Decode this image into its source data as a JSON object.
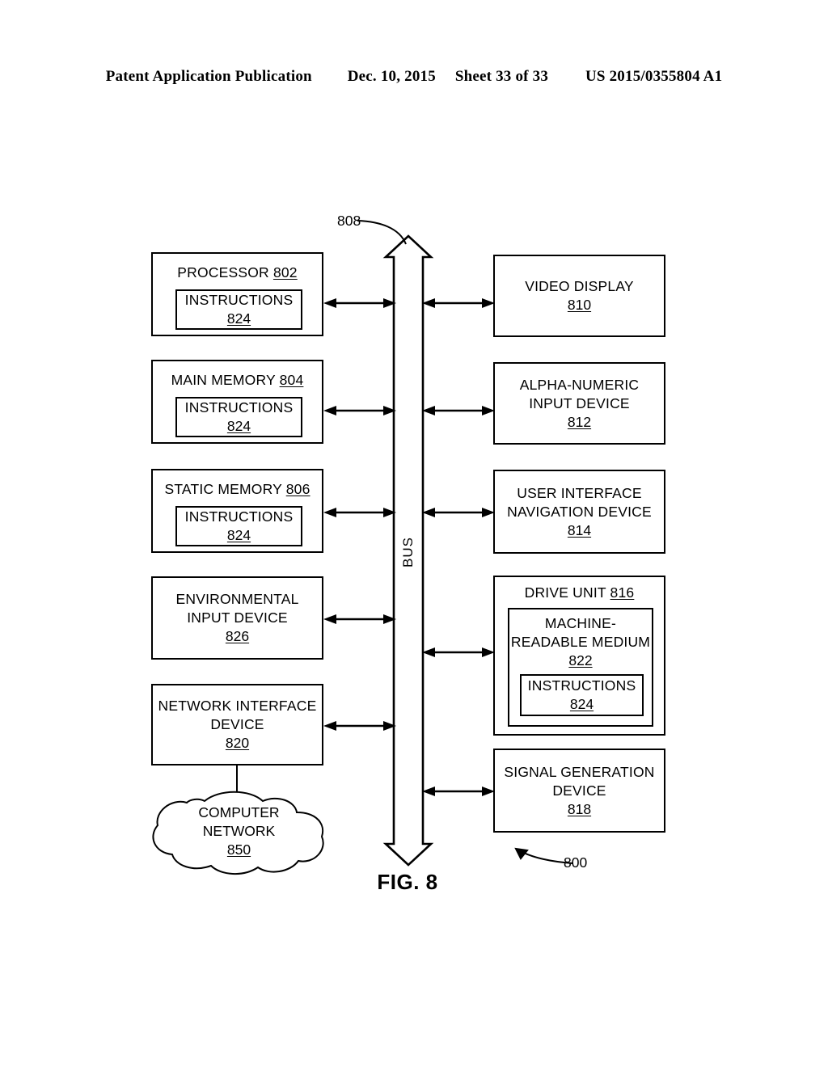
{
  "header": {
    "publication": "Patent Application Publication",
    "date": "Dec. 10, 2015",
    "sheet": "Sheet 33 of 33",
    "patent_number": "US 2015/0355804 A1"
  },
  "figure": {
    "caption": "FIG. 8",
    "system_ref": "800",
    "bus_ref": "808",
    "bus_label": "BUS"
  },
  "left_column": [
    {
      "id": "processor",
      "title": "PROCESSOR",
      "ref": "802",
      "inner": {
        "title": "INSTRUCTIONS",
        "ref": "824"
      }
    },
    {
      "id": "main-memory",
      "title": "MAIN MEMORY",
      "ref": "804",
      "inner": {
        "title": "INSTRUCTIONS",
        "ref": "824"
      }
    },
    {
      "id": "static-memory",
      "title": "STATIC MEMORY",
      "ref": "806",
      "inner": {
        "title": "INSTRUCTIONS",
        "ref": "824"
      }
    },
    {
      "id": "environmental-input-device",
      "title_line1": "ENVIRONMENTAL",
      "title_line2": "INPUT DEVICE",
      "ref": "826"
    },
    {
      "id": "network-interface-device",
      "title_line1": "NETWORK INTERFACE",
      "title_line2": "DEVICE",
      "ref": "820"
    }
  ],
  "cloud": {
    "title_line1": "COMPUTER",
    "title_line2": "NETWORK",
    "ref": "850"
  },
  "right_column": [
    {
      "id": "video-display",
      "title": "VIDEO DISPLAY",
      "ref": "810"
    },
    {
      "id": "alpha-numeric-input-device",
      "title_line1": "ALPHA-NUMERIC",
      "title_line2": "INPUT DEVICE",
      "ref": "812"
    },
    {
      "id": "user-interface-navigation-device",
      "title_line1": "USER INTERFACE",
      "title_line2": "NAVIGATION DEVICE",
      "ref": "814"
    },
    {
      "id": "drive-unit",
      "title": "DRIVE UNIT",
      "ref": "816",
      "medium": {
        "title_line1": "MACHINE-",
        "title_line2": "READABLE MEDIUM",
        "ref": "822",
        "inner": {
          "title": "INSTRUCTIONS",
          "ref": "824"
        }
      }
    },
    {
      "id": "signal-generation-device",
      "title_line1": "SIGNAL GENERATION",
      "title_line2": "DEVICE",
      "ref": "818"
    }
  ]
}
